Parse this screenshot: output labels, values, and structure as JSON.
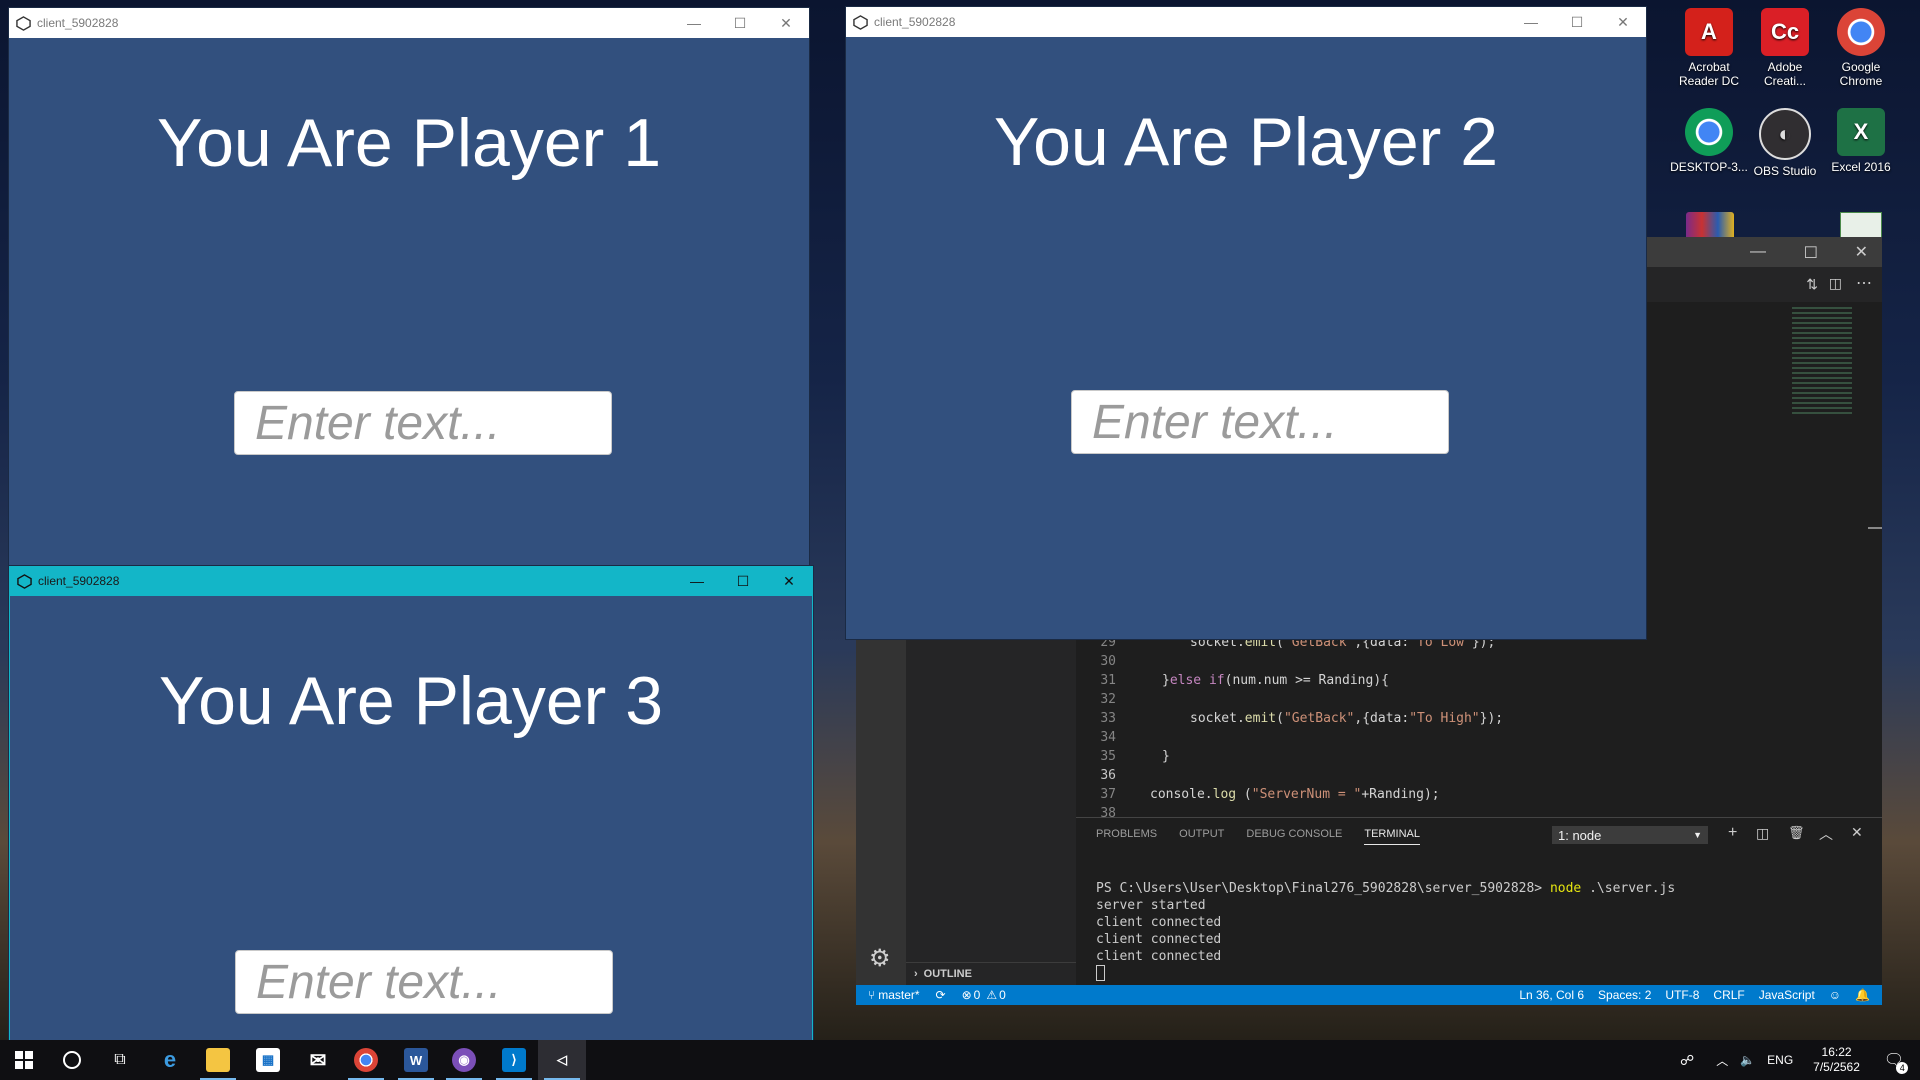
{
  "window_title": "client_5902828",
  "players": [
    {
      "heading": "You Are Player 1",
      "placeholder": "Enter text..."
    },
    {
      "heading": "You Are Player 2",
      "placeholder": "Enter text..."
    },
    {
      "heading": "You Are Player 3",
      "placeholder": "Enter text..."
    }
  ],
  "title_buttons": {
    "minimize": "—",
    "maximize": "☐",
    "close": "✕"
  },
  "desktop_icons": [
    {
      "label": "Acrobat Reader DC",
      "icon": "acrobat-icon",
      "color": "#d4211b"
    },
    {
      "label": "Adobe Creati...",
      "icon": "creative-cloud-icon",
      "color": "#da1f26"
    },
    {
      "label": "Google Chrome",
      "icon": "chrome-icon",
      "color": "#4285f4"
    },
    {
      "label": "DESKTOP-3...",
      "icon": "chrome-icon",
      "color": "#4285f4"
    },
    {
      "label": "OBS Studio",
      "icon": "obs-icon",
      "color": "#302e31"
    },
    {
      "label": "Excel 2016",
      "icon": "excel-icon",
      "color": "#1e7145"
    }
  ],
  "editor": {
    "code_lines": [
      {
        "n": "29",
        "text": "socket.emit(\"GetBack\",{data:\"To Low\"});"
      },
      {
        "n": "30",
        "text": ""
      },
      {
        "n": "31",
        "text": "}else if(num.num >= Randing){"
      },
      {
        "n": "32",
        "text": ""
      },
      {
        "n": "33",
        "text": "socket.emit(\"GetBack\",{data:\"To High\"});"
      },
      {
        "n": "34",
        "text": ""
      },
      {
        "n": "35",
        "text": "}"
      },
      {
        "n": "36",
        "text": ""
      },
      {
        "n": "37",
        "text": "console.log (\"ServerNum = \"+Randing);"
      },
      {
        "n": "38",
        "text": ""
      }
    ],
    "outline_label": "OUTLINE",
    "panel_tabs": [
      "PROBLEMS",
      "OUTPUT",
      "DEBUG CONSOLE",
      "TERMINAL"
    ],
    "active_tab": "TERMINAL",
    "terminal_select": "1: node",
    "terminal_prompt": "PS C:\\Users\\User\\Desktop\\Final276_5902828\\server_5902828>",
    "terminal_command": "node",
    "terminal_arg": ".\\server.js",
    "terminal_output": [
      "server started",
      "client connected",
      "client connected",
      "client connected"
    ],
    "status": {
      "branch": "master*",
      "errors": "0",
      "warnings": "0",
      "position": "Ln 36, Col 6",
      "spaces": "Spaces: 2",
      "encoding": "UTF-8",
      "eol": "CRLF",
      "language": "JavaScript"
    }
  },
  "taskbar": {
    "lang": "ENG",
    "time": "16:22",
    "date": "7/5/2562",
    "notifications": "4"
  }
}
